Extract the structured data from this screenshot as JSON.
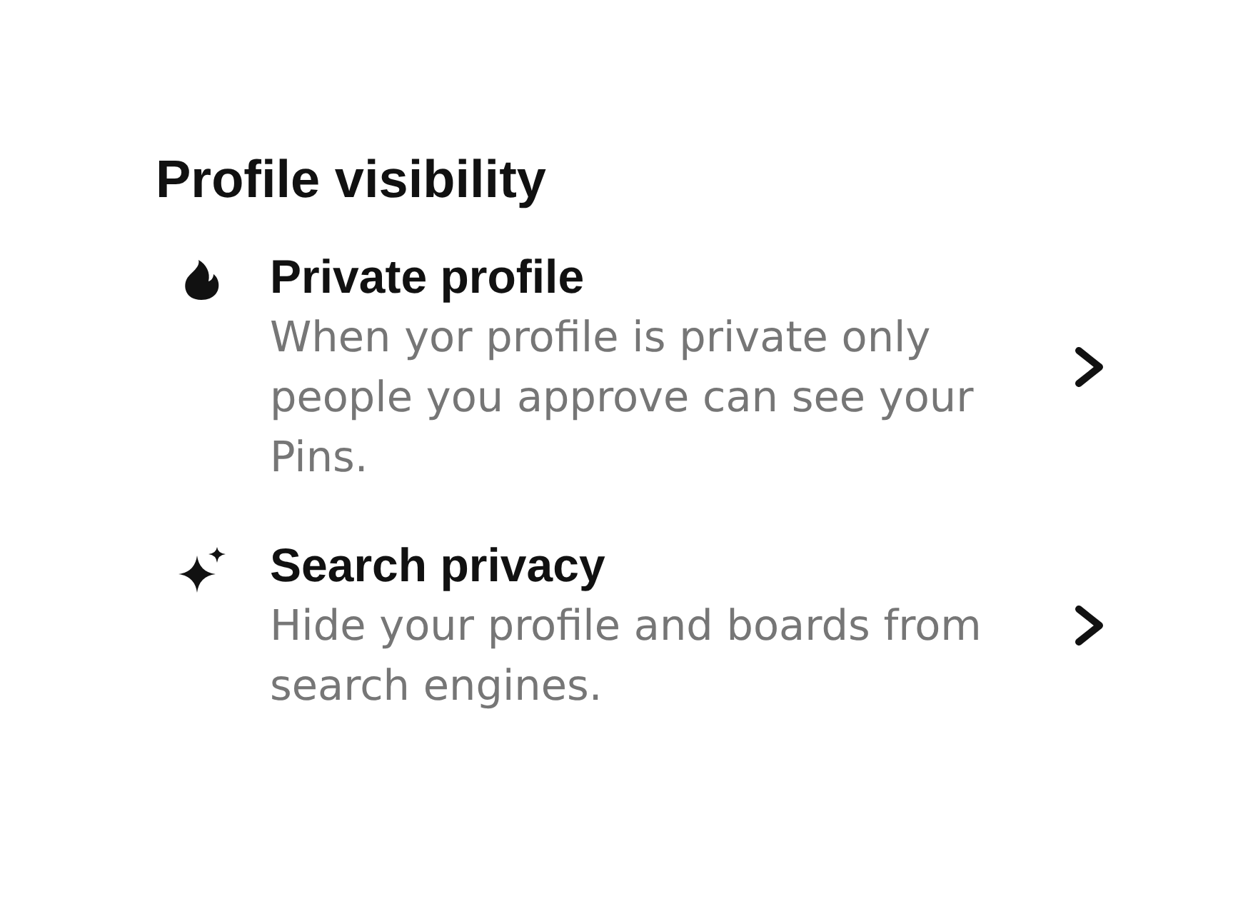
{
  "section": {
    "title": "Profile visibility"
  },
  "items": [
    {
      "title": "Private profile",
      "description": "When yor profile is private only people you approve can see your Pins."
    },
    {
      "title": "Search privacy",
      "description": "Hide your profile and boards from search engines."
    }
  ]
}
